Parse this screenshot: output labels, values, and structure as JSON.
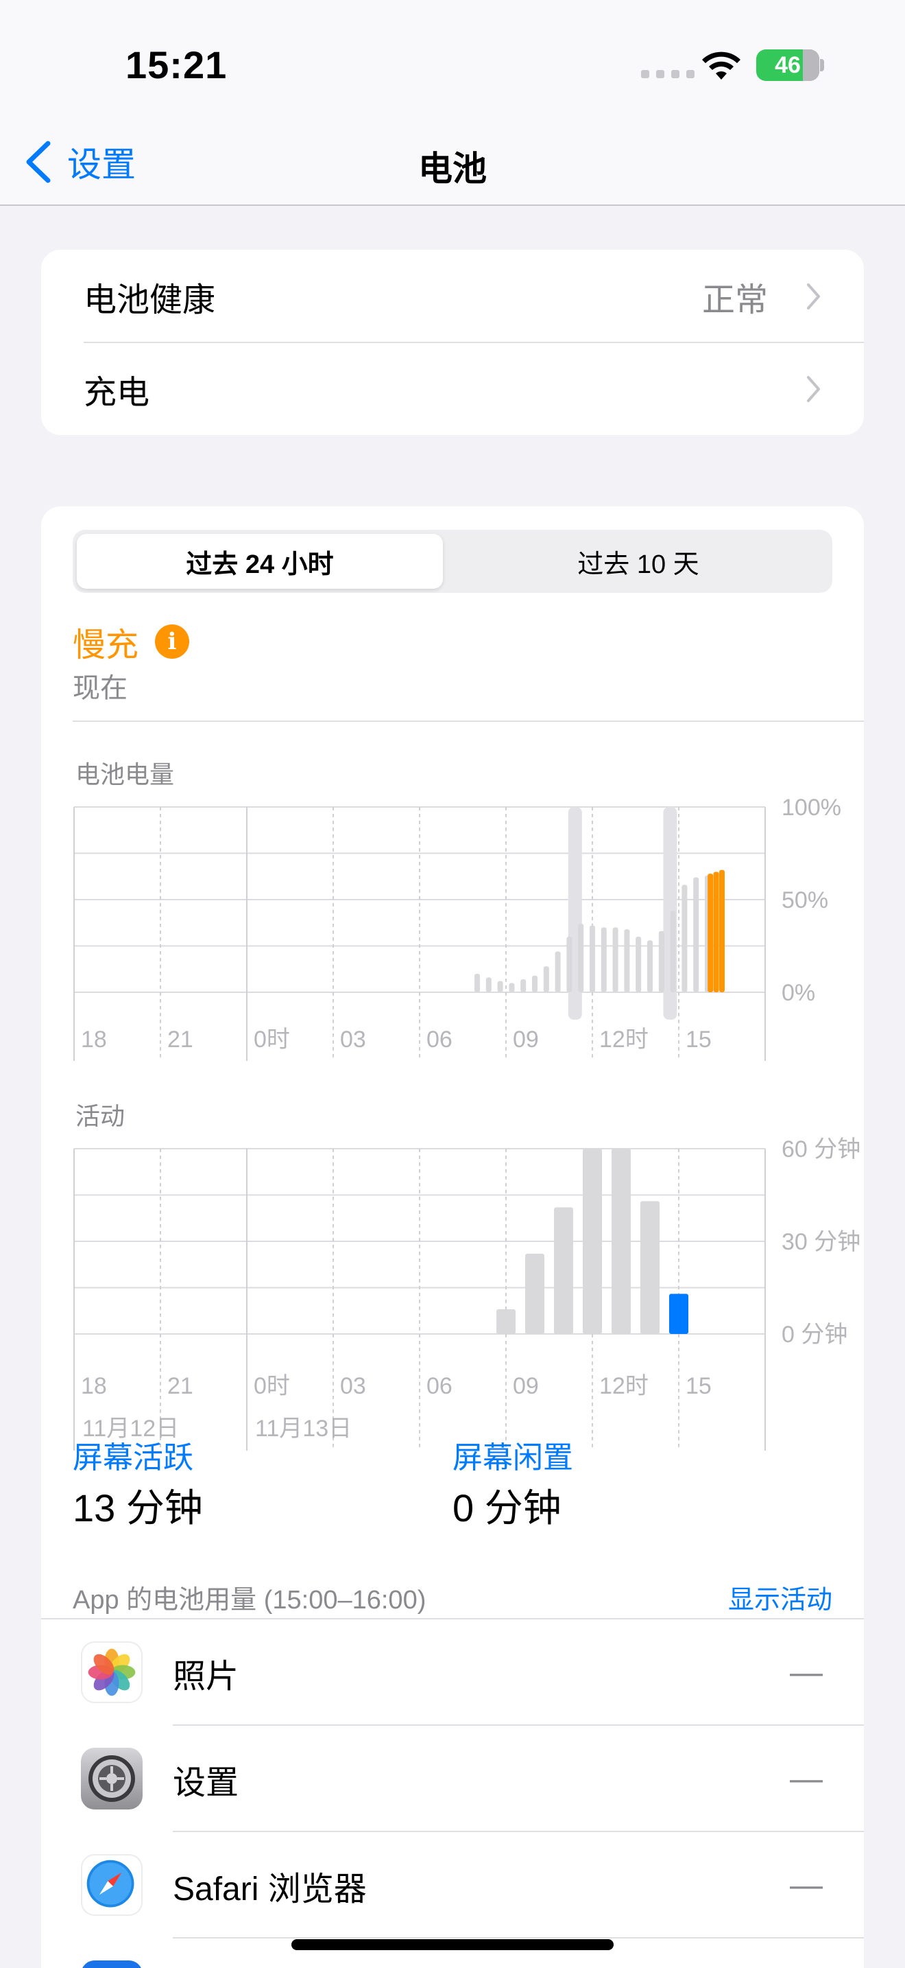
{
  "status": {
    "time": "15:21",
    "battery": "46"
  },
  "nav": {
    "back_label": "设置",
    "title": "电池"
  },
  "health_card": {
    "rows": [
      {
        "label": "电池健康",
        "value": "正常"
      },
      {
        "label": "充电",
        "value": ""
      }
    ]
  },
  "segmented": {
    "options": [
      "过去 24 小时",
      "过去 10 天"
    ],
    "selected": "过去 24 小时"
  },
  "charging_state": {
    "title": "慢充",
    "subtitle": "现在"
  },
  "battery_chart": {
    "title": "电池电量",
    "y_ticks": [
      "100%",
      "50%",
      "0%"
    ],
    "x_ticks": [
      "18",
      "21",
      "0时",
      "03",
      "06",
      "09",
      "12时",
      "15"
    ]
  },
  "activity_chart": {
    "title": "活动",
    "y_ticks": [
      "60 分钟",
      "30 分钟",
      "0 分钟"
    ],
    "x_ticks": [
      "18",
      "21",
      "0时",
      "03",
      "06",
      "09",
      "12时",
      "15"
    ],
    "date_labels": [
      "11月12日",
      "11月13日"
    ]
  },
  "chart_data": [
    {
      "type": "bar",
      "title": "电池电量",
      "x_range": [
        18,
        42
      ],
      "ylim": [
        0,
        100
      ],
      "y_unit": "%",
      "series": [
        {
          "values": [
            {
              "x": 32.0,
              "y": 10
            },
            {
              "x": 32.4,
              "y": 8
            },
            {
              "x": 32.8,
              "y": 6
            },
            {
              "x": 33.2,
              "y": 5
            },
            {
              "x": 33.6,
              "y": 7
            },
            {
              "x": 34.0,
              "y": 9
            },
            {
              "x": 34.4,
              "y": 14
            },
            {
              "x": 34.8,
              "y": 22
            },
            {
              "x": 35.2,
              "y": 30
            },
            {
              "x": 35.6,
              "y": 37
            },
            {
              "x": 36.0,
              "y": 36
            },
            {
              "x": 36.4,
              "y": 35
            },
            {
              "x": 36.8,
              "y": 35
            },
            {
              "x": 37.2,
              "y": 34
            },
            {
              "x": 37.6,
              "y": 30
            },
            {
              "x": 38.0,
              "y": 28
            },
            {
              "x": 38.4,
              "y": 33
            },
            {
              "x": 38.8,
              "y": 44
            },
            {
              "x": 39.2,
              "y": 58
            },
            {
              "x": 39.6,
              "y": 62
            },
            {
              "x": 40.0,
              "y": 63
            }
          ]
        },
        {
          "name": "慢充",
          "color": "#ff9500",
          "values": [
            {
              "x": 40.1,
              "y": 64
            },
            {
              "x": 40.3,
              "y": 65
            },
            {
              "x": 40.5,
              "y": 66
            }
          ]
        }
      ]
    },
    {
      "type": "bar",
      "title": "活动",
      "x_range": [
        18,
        42
      ],
      "ylim": [
        0,
        60
      ],
      "y_unit": "分钟",
      "series": [
        {
          "values": [
            {
              "x": 33,
              "y": 8
            },
            {
              "x": 34,
              "y": 26
            },
            {
              "x": 35,
              "y": 41
            },
            {
              "x": 36,
              "y": 60
            },
            {
              "x": 37,
              "y": 60
            },
            {
              "x": 38,
              "y": 43
            }
          ]
        },
        {
          "color": "#007aff",
          "values": [
            {
              "x": 39,
              "y": 13
            }
          ]
        }
      ]
    }
  ],
  "screen_stats": {
    "active_label": "屏幕活跃",
    "active_value": "13 分钟",
    "idle_label": "屏幕闲置",
    "idle_value": "0 分钟"
  },
  "usage": {
    "header": "App 的电池用量 (15:00–16:00)",
    "show_activity": "显示活动",
    "apps": [
      {
        "name": "照片",
        "value": "—",
        "icon": "photos-icon"
      },
      {
        "name": "设置",
        "value": "—",
        "icon": "settings-icon"
      },
      {
        "name": "Safari 浏览器",
        "value": "—",
        "icon": "safari-icon"
      }
    ]
  }
}
